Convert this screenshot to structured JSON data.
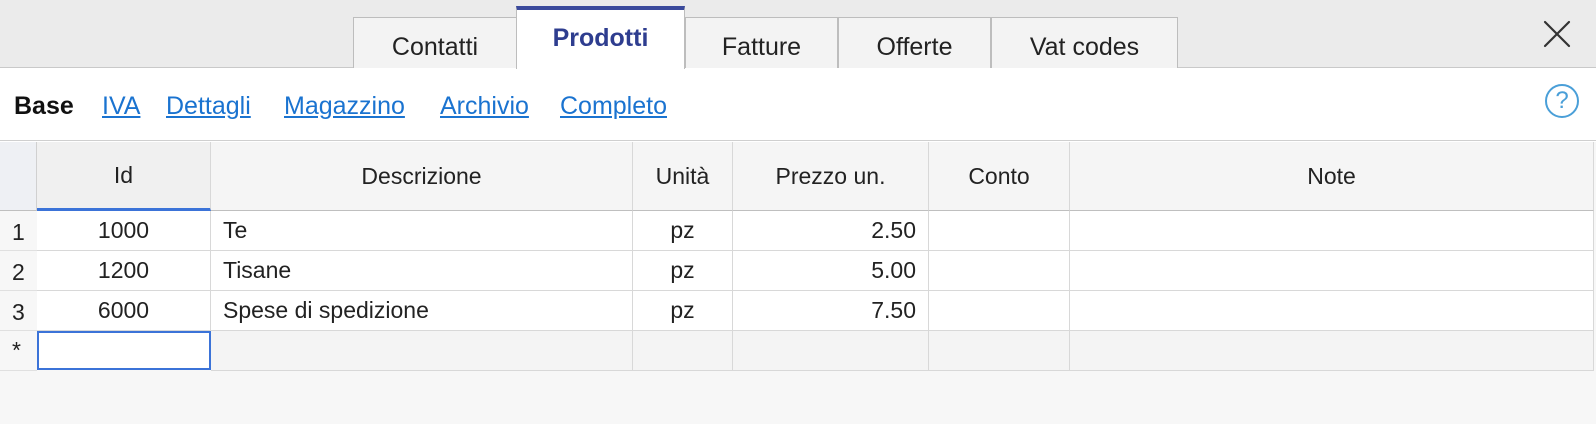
{
  "tabs": [
    {
      "label": "Contatti",
      "active": false
    },
    {
      "label": "Prodotti",
      "active": true
    },
    {
      "label": "Fatture",
      "active": false
    },
    {
      "label": "Offerte",
      "active": false
    },
    {
      "label": "Vat codes",
      "active": false
    }
  ],
  "views": [
    {
      "label": "Base",
      "current": true
    },
    {
      "label": "IVA",
      "current": false
    },
    {
      "label": "Dettagli",
      "current": false
    },
    {
      "label": "Magazzino",
      "current": false
    },
    {
      "label": "Archivio",
      "current": false
    },
    {
      "label": "Completo",
      "current": false
    }
  ],
  "help_label": "?",
  "table": {
    "columns": [
      "Id",
      "Descrizione",
      "Unità",
      "Prezzo un.",
      "Conto",
      "Note"
    ],
    "rows": [
      {
        "num": "1",
        "id": "1000",
        "descrizione": "Te",
        "unita": "pz",
        "prezzo": "2.50",
        "conto": "",
        "note": ""
      },
      {
        "num": "2",
        "id": "1200",
        "descrizione": "Tisane",
        "unita": "pz",
        "prezzo": "5.00",
        "conto": "",
        "note": ""
      },
      {
        "num": "3",
        "id": "6000",
        "descrizione": "Spese di spedizione",
        "unita": "pz",
        "prezzo": "7.50",
        "conto": "",
        "note": ""
      }
    ],
    "new_row_marker": "*"
  },
  "colors": {
    "accent": "#3b4a9c",
    "link": "#1a73d0",
    "selection": "#3b73d8",
    "help": "#4a9fd8"
  },
  "icons": {
    "close": "close-icon",
    "help": "help-icon"
  }
}
